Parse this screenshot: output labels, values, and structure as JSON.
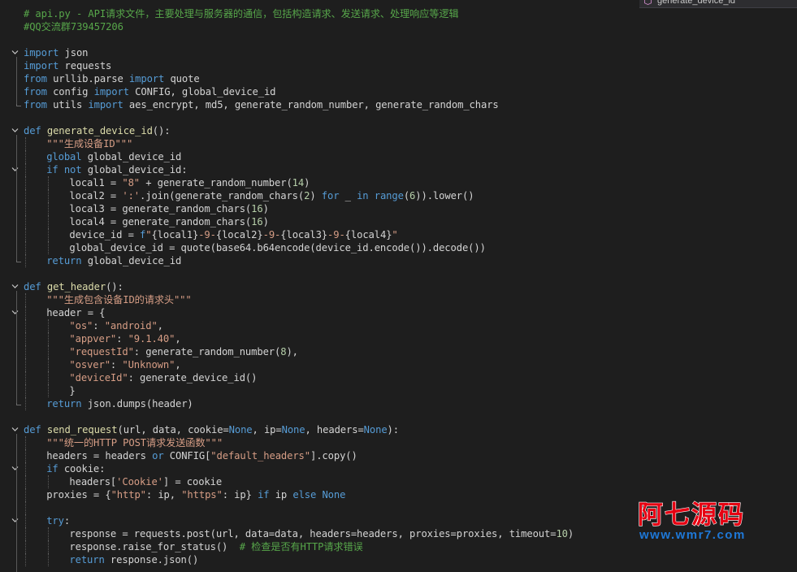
{
  "tab": {
    "label": "generate_device_id"
  },
  "watermark": {
    "title": "阿七源码",
    "url": "www.wmr7.com"
  },
  "colors": {
    "background": "#1e1e1e",
    "keyword": "#569cd6",
    "identifier": "#d4d4d4",
    "function": "#dcdcaa",
    "string": "#d69d85",
    "number": "#b5cea8",
    "comment": "#57a64a",
    "operator": "#b4b4b4"
  },
  "code": {
    "lines": [
      {
        "indent": 0,
        "fold": "",
        "tokens": [
          {
            "t": "cm",
            "v": "# api.py - API请求文件，主要处理与服务器的通信，包括构造请求、发送请求、处理响应等逻辑"
          }
        ]
      },
      {
        "indent": 0,
        "fold": "",
        "tokens": [
          {
            "t": "cm",
            "v": "#QQ交流群739457206"
          }
        ]
      },
      {
        "indent": 0,
        "fold": "",
        "tokens": []
      },
      {
        "indent": 0,
        "fold": "open",
        "tokens": [
          {
            "t": "kw",
            "v": "import"
          },
          {
            "t": "id",
            "v": " json"
          }
        ]
      },
      {
        "indent": 0,
        "fold": "",
        "tokens": [
          {
            "t": "kw",
            "v": "import"
          },
          {
            "t": "id",
            "v": " requests"
          }
        ]
      },
      {
        "indent": 0,
        "fold": "",
        "tokens": [
          {
            "t": "kw",
            "v": "from"
          },
          {
            "t": "id",
            "v": " urllib.parse "
          },
          {
            "t": "kw",
            "v": "import"
          },
          {
            "t": "id",
            "v": " quote"
          }
        ]
      },
      {
        "indent": 0,
        "fold": "",
        "tokens": [
          {
            "t": "kw",
            "v": "from"
          },
          {
            "t": "id",
            "v": " config "
          },
          {
            "t": "kw",
            "v": "import"
          },
          {
            "t": "id",
            "v": " CONFIG, global_device_id"
          }
        ]
      },
      {
        "indent": 0,
        "fold": "end",
        "tokens": [
          {
            "t": "kw",
            "v": "from"
          },
          {
            "t": "id",
            "v": " utils "
          },
          {
            "t": "kw",
            "v": "import"
          },
          {
            "t": "id",
            "v": " aes_encrypt, md5, generate_random_number, generate_random_chars"
          }
        ]
      },
      {
        "indent": 0,
        "fold": "",
        "tokens": []
      },
      {
        "indent": 0,
        "fold": "open",
        "tokens": [
          {
            "t": "kw",
            "v": "def"
          },
          {
            "t": "id",
            "v": " "
          },
          {
            "t": "fn",
            "v": "generate_device_id"
          },
          {
            "t": "id",
            "v": "():"
          }
        ]
      },
      {
        "indent": 1,
        "fold": "",
        "tokens": [
          {
            "t": "str",
            "v": "\"\"\"生成设备ID\"\"\""
          }
        ]
      },
      {
        "indent": 1,
        "fold": "",
        "tokens": [
          {
            "t": "kw",
            "v": "global"
          },
          {
            "t": "id",
            "v": " global_device_id"
          }
        ]
      },
      {
        "indent": 1,
        "fold": "open",
        "tokens": [
          {
            "t": "kw",
            "v": "if not"
          },
          {
            "t": "id",
            "v": " global_device_id:"
          }
        ]
      },
      {
        "indent": 2,
        "fold": "",
        "tokens": [
          {
            "t": "id",
            "v": "local1 = "
          },
          {
            "t": "str",
            "v": "\"8\""
          },
          {
            "t": "id",
            "v": " + generate_random_number("
          },
          {
            "t": "num",
            "v": "14"
          },
          {
            "t": "id",
            "v": ")"
          }
        ]
      },
      {
        "indent": 2,
        "fold": "",
        "tokens": [
          {
            "t": "id",
            "v": "local2 = "
          },
          {
            "t": "str",
            "v": "':'"
          },
          {
            "t": "id",
            "v": ".join(generate_random_chars("
          },
          {
            "t": "num",
            "v": "2"
          },
          {
            "t": "id",
            "v": ") "
          },
          {
            "t": "kw",
            "v": "for"
          },
          {
            "t": "id",
            "v": " _ "
          },
          {
            "t": "kw",
            "v": "in"
          },
          {
            "t": "id",
            "v": " "
          },
          {
            "t": "kw",
            "v": "range"
          },
          {
            "t": "id",
            "v": "("
          },
          {
            "t": "num",
            "v": "6"
          },
          {
            "t": "id",
            "v": ")).lower()"
          }
        ]
      },
      {
        "indent": 2,
        "fold": "",
        "tokens": [
          {
            "t": "id",
            "v": "local3 = generate_random_chars("
          },
          {
            "t": "num",
            "v": "16"
          },
          {
            "t": "id",
            "v": ")"
          }
        ]
      },
      {
        "indent": 2,
        "fold": "",
        "tokens": [
          {
            "t": "id",
            "v": "local4 = generate_random_chars("
          },
          {
            "t": "num",
            "v": "16"
          },
          {
            "t": "id",
            "v": ")"
          }
        ]
      },
      {
        "indent": 2,
        "fold": "",
        "tokens": [
          {
            "t": "id",
            "v": "device_id = "
          },
          {
            "t": "kw",
            "v": "f"
          },
          {
            "t": "str",
            "v": "\""
          },
          {
            "t": "id",
            "v": "{local1}"
          },
          {
            "t": "str",
            "v": "-9-"
          },
          {
            "t": "id",
            "v": "{local2}"
          },
          {
            "t": "str",
            "v": "-9-"
          },
          {
            "t": "id",
            "v": "{local3}"
          },
          {
            "t": "str",
            "v": "-9-"
          },
          {
            "t": "id",
            "v": "{local4}"
          },
          {
            "t": "str",
            "v": "\""
          }
        ]
      },
      {
        "indent": 2,
        "fold": "",
        "tokens": [
          {
            "t": "id",
            "v": "global_device_id = quote(base64.b64encode(device_id.encode()).decode())"
          }
        ]
      },
      {
        "indent": 1,
        "fold": "end",
        "tokens": [
          {
            "t": "kw",
            "v": "return"
          },
          {
            "t": "id",
            "v": " global_device_id"
          }
        ]
      },
      {
        "indent": 0,
        "fold": "",
        "tokens": []
      },
      {
        "indent": 0,
        "fold": "open",
        "tokens": [
          {
            "t": "kw",
            "v": "def"
          },
          {
            "t": "id",
            "v": " "
          },
          {
            "t": "fn",
            "v": "get_header"
          },
          {
            "t": "id",
            "v": "():"
          }
        ]
      },
      {
        "indent": 1,
        "fold": "",
        "tokens": [
          {
            "t": "str",
            "v": "\"\"\"生成包含设备ID的请求头\"\"\""
          }
        ]
      },
      {
        "indent": 1,
        "fold": "open",
        "tokens": [
          {
            "t": "id",
            "v": "header = {"
          }
        ]
      },
      {
        "indent": 2,
        "fold": "",
        "tokens": [
          {
            "t": "str",
            "v": "\"os\""
          },
          {
            "t": "id",
            "v": ": "
          },
          {
            "t": "str",
            "v": "\"android\""
          },
          {
            "t": "id",
            "v": ","
          }
        ]
      },
      {
        "indent": 2,
        "fold": "",
        "tokens": [
          {
            "t": "str",
            "v": "\"appver\""
          },
          {
            "t": "id",
            "v": ": "
          },
          {
            "t": "str",
            "v": "\"9.1.40\""
          },
          {
            "t": "id",
            "v": ","
          }
        ]
      },
      {
        "indent": 2,
        "fold": "",
        "tokens": [
          {
            "t": "str",
            "v": "\"requestId\""
          },
          {
            "t": "id",
            "v": ": generate_random_number("
          },
          {
            "t": "num",
            "v": "8"
          },
          {
            "t": "id",
            "v": "),"
          }
        ]
      },
      {
        "indent": 2,
        "fold": "",
        "tokens": [
          {
            "t": "str",
            "v": "\"osver\""
          },
          {
            "t": "id",
            "v": ": "
          },
          {
            "t": "str",
            "v": "\"Unknown\""
          },
          {
            "t": "id",
            "v": ","
          }
        ]
      },
      {
        "indent": 2,
        "fold": "",
        "tokens": [
          {
            "t": "str",
            "v": "\"deviceId\""
          },
          {
            "t": "id",
            "v": ": generate_device_id()"
          }
        ]
      },
      {
        "indent": 2,
        "fold": "",
        "tokens": [
          {
            "t": "id",
            "v": "}"
          }
        ]
      },
      {
        "indent": 1,
        "fold": "end",
        "tokens": [
          {
            "t": "kw",
            "v": "return"
          },
          {
            "t": "id",
            "v": " json.dumps(header)"
          }
        ]
      },
      {
        "indent": 0,
        "fold": "",
        "tokens": []
      },
      {
        "indent": 0,
        "fold": "open",
        "tokens": [
          {
            "t": "kw",
            "v": "def"
          },
          {
            "t": "id",
            "v": " "
          },
          {
            "t": "fn",
            "v": "send_request"
          },
          {
            "t": "id",
            "v": "(url, data, cookie="
          },
          {
            "t": "kw",
            "v": "None"
          },
          {
            "t": "id",
            "v": ", ip="
          },
          {
            "t": "kw",
            "v": "None"
          },
          {
            "t": "id",
            "v": ", headers="
          },
          {
            "t": "kw",
            "v": "None"
          },
          {
            "t": "id",
            "v": "):"
          }
        ]
      },
      {
        "indent": 1,
        "fold": "",
        "tokens": [
          {
            "t": "str",
            "v": "\"\"\"统一的HTTP POST请求发送函数\"\"\""
          }
        ]
      },
      {
        "indent": 1,
        "fold": "",
        "tokens": [
          {
            "t": "id",
            "v": "headers = headers "
          },
          {
            "t": "kw",
            "v": "or"
          },
          {
            "t": "id",
            "v": " CONFIG["
          },
          {
            "t": "str",
            "v": "\"default_headers\""
          },
          {
            "t": "id",
            "v": "].copy()"
          }
        ]
      },
      {
        "indent": 1,
        "fold": "open",
        "tokens": [
          {
            "t": "kw",
            "v": "if"
          },
          {
            "t": "id",
            "v": " cookie:"
          }
        ]
      },
      {
        "indent": 2,
        "fold": "",
        "tokens": [
          {
            "t": "id",
            "v": "headers["
          },
          {
            "t": "str",
            "v": "'Cookie'"
          },
          {
            "t": "id",
            "v": "] = cookie"
          }
        ]
      },
      {
        "indent": 1,
        "fold": "",
        "tokens": [
          {
            "t": "id",
            "v": "proxies = {"
          },
          {
            "t": "str",
            "v": "\"http\""
          },
          {
            "t": "id",
            "v": ": ip, "
          },
          {
            "t": "str",
            "v": "\"https\""
          },
          {
            "t": "id",
            "v": ": ip} "
          },
          {
            "t": "kw",
            "v": "if"
          },
          {
            "t": "id",
            "v": " ip "
          },
          {
            "t": "kw",
            "v": "else"
          },
          {
            "t": "id",
            "v": " "
          },
          {
            "t": "kw",
            "v": "None"
          }
        ]
      },
      {
        "indent": 1,
        "fold": "",
        "tokens": []
      },
      {
        "indent": 1,
        "fold": "open",
        "tokens": [
          {
            "t": "kw",
            "v": "try"
          },
          {
            "t": "id",
            "v": ":"
          }
        ]
      },
      {
        "indent": 2,
        "fold": "",
        "tokens": [
          {
            "t": "id",
            "v": "response = requests.post(url, data=data, headers=headers, proxies=proxies, timeout="
          },
          {
            "t": "num",
            "v": "10"
          },
          {
            "t": "id",
            "v": ")"
          }
        ]
      },
      {
        "indent": 2,
        "fold": "",
        "tokens": [
          {
            "t": "id",
            "v": "response.raise_for_status()  "
          },
          {
            "t": "cm",
            "v": "# 检查是否有HTTP请求错误"
          }
        ]
      },
      {
        "indent": 2,
        "fold": "",
        "tokens": [
          {
            "t": "kw",
            "v": "return"
          },
          {
            "t": "id",
            "v": " response.json()"
          }
        ]
      }
    ]
  }
}
